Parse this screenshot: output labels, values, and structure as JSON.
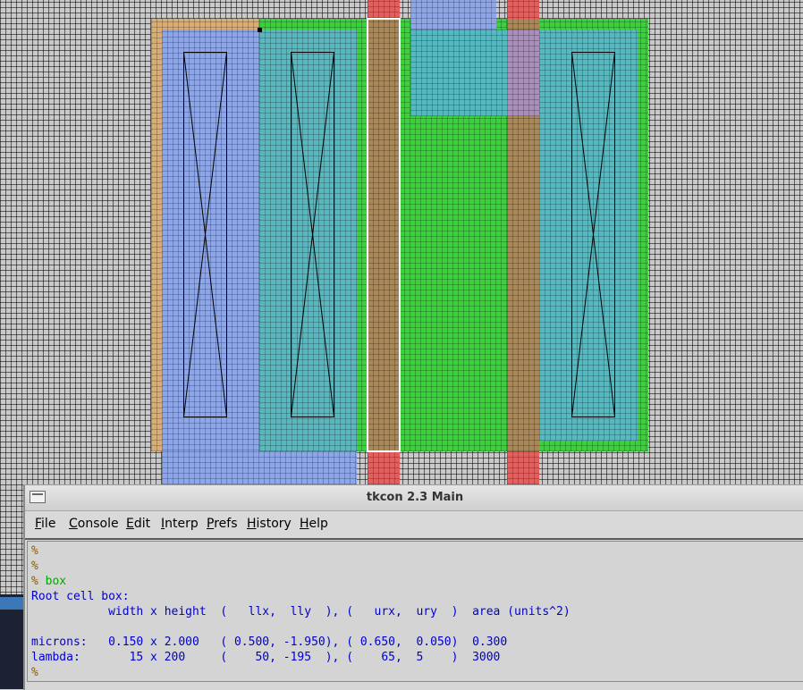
{
  "window": {
    "title": "tkcon 2.3 Main"
  },
  "menu": [
    {
      "label": "File",
      "u": "F",
      "rest": "ile"
    },
    {
      "label": "Console",
      "u": "C",
      "rest": "onsole"
    },
    {
      "label": "Edit",
      "u": "E",
      "rest": "dit"
    },
    {
      "label": "Interp",
      "u": "I",
      "rest": "nterp"
    },
    {
      "label": "Prefs",
      "u": "P",
      "rest": "refs"
    },
    {
      "label": "History",
      "u": "H",
      "rest": "istory"
    },
    {
      "label": "Help",
      "u": "H",
      "rest": "elp"
    }
  ],
  "console": {
    "prompt": "%",
    "command": "box",
    "lines": [
      "Root cell box:",
      "           width x height  (   llx,  lly  ), (   urx,  ury  )  area (units^2)",
      "",
      "microns:   0.150 x 2.000   ( 0.500, -1.950), ( 0.650,  0.050)  0.300",
      "lambda:       15 x 200     (    50, -195  ), (    65,  5    )  3000"
    ]
  },
  "colors": {
    "pdiff": "#8ea6e6",
    "ndiff": "#3ad23a",
    "nwell_overlap": "#58b8c0",
    "poly": "#e06060",
    "poly_over_diff": "#a88858",
    "well_tan": "#d8b078",
    "prompt": "#8b5a00",
    "command": "#00a800",
    "output": "#0000d0"
  }
}
